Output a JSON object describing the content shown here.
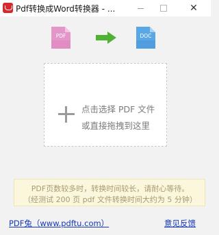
{
  "window": {
    "title": "Pdf转换成Word转换器 - ...",
    "close_glyph": "✕"
  },
  "icons": {
    "pdf_label": "PDF",
    "doc_label": "DOC"
  },
  "drop_zone": {
    "line1": "点击选择 PDF 文件",
    "line2": "或直接拖拽到这里"
  },
  "notice": {
    "line1": "PDF页数较多时，转换时间较长，请耐心等待。",
    "line2": "（经测试 200 页 pdf 文件转换时间大约为 5 分钟）"
  },
  "footer": {
    "left_link": "PDF兔（www.pdftu.com）",
    "right_link": "意见反馈"
  },
  "colors": {
    "pdf_icon": "#e596c9",
    "doc_icon": "#5aa7e6",
    "arrow": "#4fb234",
    "app_icon": "#d9272e",
    "link": "#1538b8"
  }
}
